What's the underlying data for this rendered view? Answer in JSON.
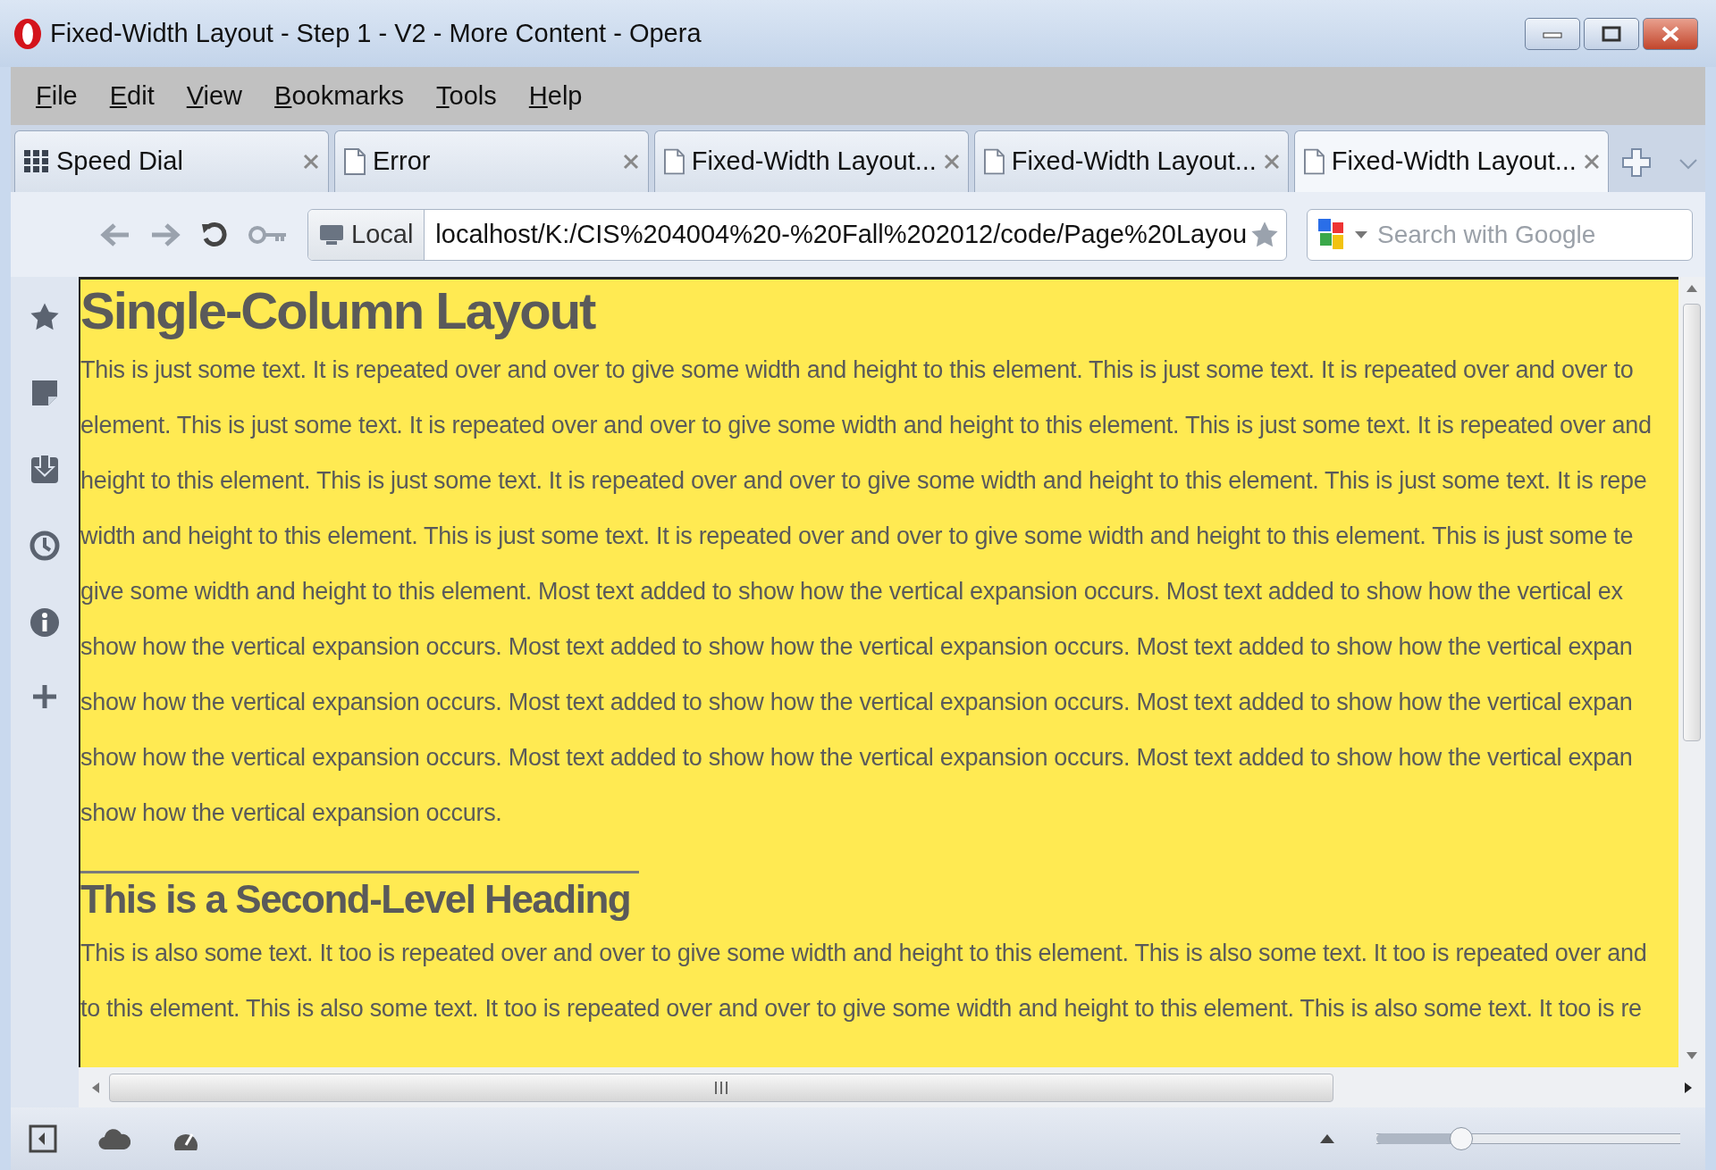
{
  "window": {
    "title": "Fixed-Width Layout - Step 1 - V2 - More Content - Opera"
  },
  "menu": [
    {
      "label": "File"
    },
    {
      "label": "Edit"
    },
    {
      "label": "View"
    },
    {
      "label": "Bookmarks"
    },
    {
      "label": "Tools"
    },
    {
      "label": "Help"
    }
  ],
  "tabs": [
    {
      "label": "Speed Dial",
      "kind": "speed-dial",
      "selected": false
    },
    {
      "label": "Error",
      "kind": "page",
      "selected": false
    },
    {
      "label": "Fixed-Width Layout...",
      "kind": "page",
      "selected": false
    },
    {
      "label": "Fixed-Width Layout...",
      "kind": "page",
      "selected": false
    },
    {
      "label": "Fixed-Width Layout...",
      "kind": "page",
      "selected": true
    }
  ],
  "address_bar": {
    "zone": "Local",
    "url": "localhost/K:/CIS%204004%20-%20Fall%202012/code/Page%20Layou"
  },
  "search": {
    "placeholder": "Search with Google"
  },
  "page": {
    "heading": "Single-Column Layout",
    "paragraph_lines": [
      "This is just some text. It is repeated over and over to give some width and height to this element. This is just some text. It is repeated over and over to",
      "element. This is just some text. It is repeated over and over to give some width and height to this element. This is just some text. It is repeated over and",
      "height to this element. This is just some text. It is repeated over and over to give some width and height to this element. This is just some text. It is repe",
      "width and height to this element. This is just some text. It is repeated over and over to give some width and height to this element. This is just some te",
      "give some width and height to this element. Most text added to show how the vertical expansion occurs. Most text added to show how the vertical ex",
      "show how the vertical expansion occurs. Most text added to show how the vertical expansion occurs. Most text added to show how the vertical expan",
      "show how the vertical expansion occurs. Most text added to show how the vertical expansion occurs. Most text added to show how the vertical expan",
      "show how the vertical expansion occurs. Most text added to show how the vertical expansion occurs. Most text added to show how the vertical expan",
      "show how the vertical expansion occurs."
    ],
    "subheading": "This is a Second-Level Heading",
    "paragraph2_lines": [
      "This is also some text. It too is repeated over and over to give some width and height to this element. This is also some text. It too is repeated over and",
      "to this element. This is also some text. It too is repeated over and over to give some width and height to this element. This is also some text. It too is re"
    ]
  },
  "zoom_slider": {
    "level": 0.28
  }
}
